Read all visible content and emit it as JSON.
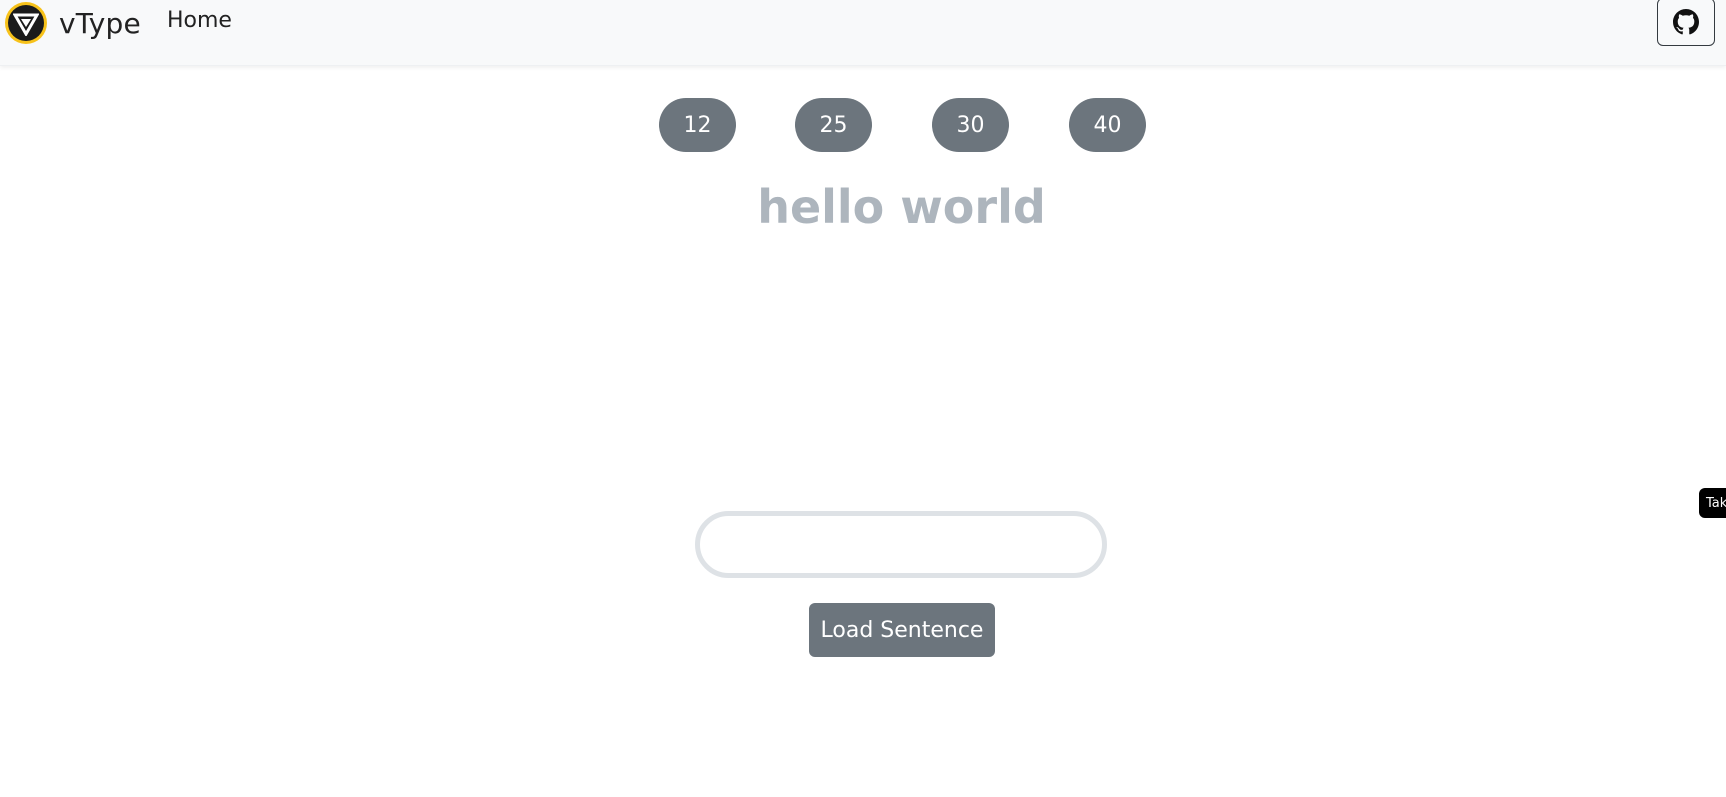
{
  "navbar": {
    "brand": "vType",
    "home_link": "Home",
    "logo_icon": "vtype-logo-icon",
    "github_icon": "github-icon"
  },
  "length_options": [
    "12",
    "25",
    "30",
    "40"
  ],
  "sentence": "hello world",
  "typing_input": {
    "value": "",
    "placeholder": ""
  },
  "load_button": "Load Sentence",
  "side_tab": "Tak",
  "colors": {
    "navbar_bg": "#f8f9fa",
    "secondary": "#6c757d",
    "sentence_text": "#adb5bd",
    "input_border": "#dee2e6",
    "logo_ring": "#f7c21a"
  }
}
